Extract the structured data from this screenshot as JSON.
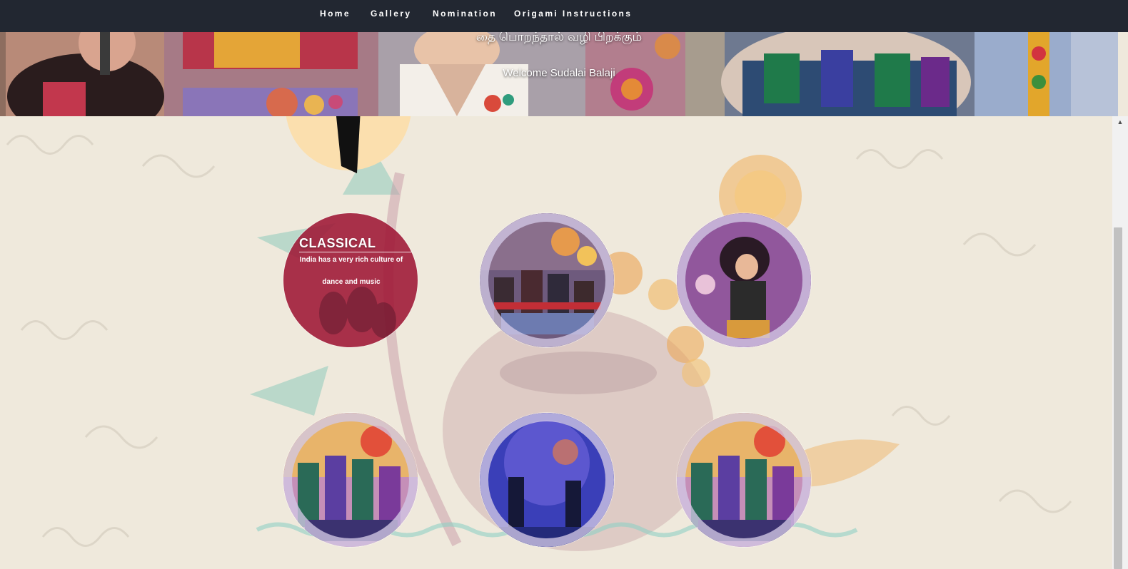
{
  "nav": {
    "items": [
      {
        "label": "Home"
      },
      {
        "label": "Gallery"
      },
      {
        "label": "Nomination"
      },
      {
        "label": "Origami Instructions"
      }
    ]
  },
  "banner": {
    "tagline": "தை பொறந்தால் வழி பிறக்கும்",
    "welcome": "Welcome Sudalai Balaji"
  },
  "gallery": {
    "items": [
      {
        "title": "CLASSICAL",
        "text": "India has a very rich culture of dance and music"
      },
      {
        "title": "",
        "text": ""
      },
      {
        "title": "",
        "text": ""
      },
      {
        "title": "",
        "text": ""
      },
      {
        "title": "",
        "text": ""
      },
      {
        "title": "",
        "text": ""
      }
    ]
  },
  "colors": {
    "nav_bg": "#222731",
    "classical_overlay": "#9e1634",
    "page_bg": "#efe9dc"
  }
}
